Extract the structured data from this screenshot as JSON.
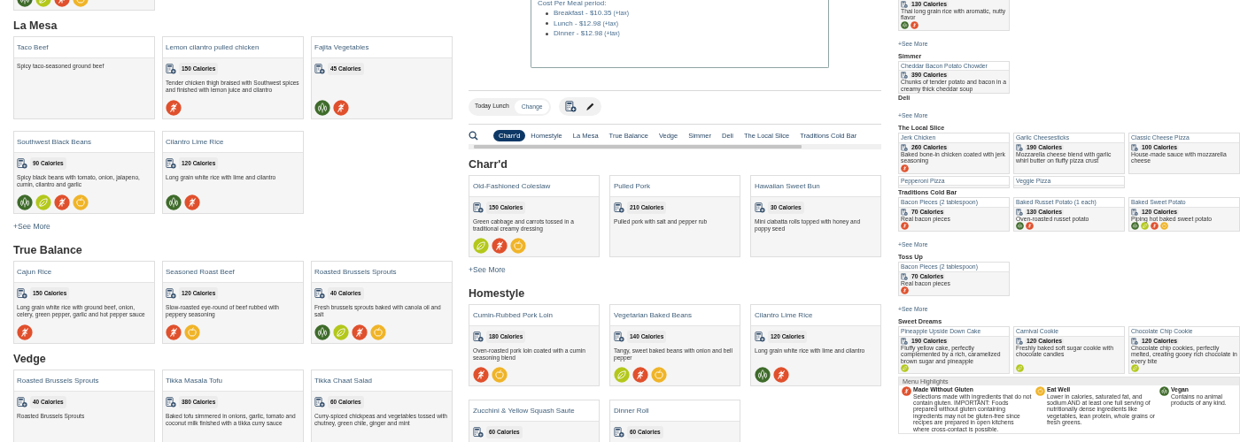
{
  "left_panel": {
    "sections": [
      {
        "items": [
          {
            "badges": [
              {
                "kind": "vegan"
              },
              {
                "kind": "vegetarian"
              },
              {
                "kind": "gluten"
              },
              {
                "kind": "eatwell"
              }
            ]
          }
        ]
      },
      {
        "title": "La Mesa",
        "see_more": "+See More",
        "items": [
          {
            "name": "Taco Beef",
            "description": "Spicy taco-seasoned ground beef"
          },
          {
            "name": "Lemon cilantro pulled chicken",
            "calories": "150 Calories",
            "description": "Tender chicken thigh braised with Southwest spices and finished with lemon juice and cilantro",
            "badges": [
              {
                "kind": "gluten"
              }
            ]
          },
          {
            "name": "Fajita Vegetables",
            "calories": "45 Calories",
            "badges": [
              {
                "kind": "vegan"
              },
              {
                "kind": "gluten"
              }
            ]
          },
          {
            "name": "Southwest Black Beans",
            "calories": "90 Calories",
            "description": "Spicy black beans with tomato, onion, jalapeno, cumin, cilantro and garlic",
            "badges": [
              {
                "kind": "vegan"
              },
              {
                "kind": "vegetarian"
              },
              {
                "kind": "gluten"
              },
              {
                "kind": "eatwell"
              }
            ]
          },
          {
            "name": "Cilantro Lime Rice",
            "calories": "120 Calories",
            "description": "Long grain white rice with lime and cilantro",
            "badges": [
              {
                "kind": "vegan"
              },
              {
                "kind": "gluten"
              }
            ]
          }
        ]
      },
      {
        "title": "True Balance",
        "items": [
          {
            "name": "Cajun Rice",
            "calories": "150 Calories",
            "description": "Long grain white rice with ground beef, onion, celery, green pepper, garlic and hot pepper sauce",
            "badges": [
              {
                "kind": "gluten"
              }
            ]
          },
          {
            "name": "Seasoned Roast Beef",
            "calories": "120 Calories",
            "description": "Slow-roasted eye-round of beef rubbed with peppery seasoning",
            "badges": [
              {
                "kind": "gluten"
              },
              {
                "kind": "eatwell"
              }
            ]
          },
          {
            "name": "Roasted Brussels Sprouts",
            "calories": "40 Calories",
            "description": "Fresh brussels sprouts baked with canola oil and salt",
            "badges": [
              {
                "kind": "vegan"
              },
              {
                "kind": "vegetarian"
              },
              {
                "kind": "gluten"
              },
              {
                "kind": "eatwell"
              }
            ]
          }
        ]
      },
      {
        "title": "Vedge",
        "items": [
          {
            "name": "Roasted Brussels Sprouts",
            "calories": "40 Calories",
            "description": "Roasted Brussels Sprouts"
          },
          {
            "name": "Tikka Masala Tofu",
            "calories": "380 Calories",
            "description": "Baked tofu simmered in onions, garlic, tomato and coconut milk finished with a tikka curry sauce"
          },
          {
            "name": "Tikka Chaat Salad",
            "calories": "60 Calories",
            "description": "Curry-spiced chickpeas and vegetables tossed with chutney, green chile, ginger and mint"
          }
        ]
      }
    ]
  },
  "middle_panel": {
    "cost": {
      "heading": "Cost Per Meal period:",
      "items": [
        {
          "text": "Breakfast - $10.35",
          "note": "(+tax)"
        },
        {
          "text": "Lunch - $12.98",
          "note": "(+tax)"
        },
        {
          "text": "Dinner - $12.98",
          "note": "(+tax)"
        }
      ]
    },
    "toolbar": {
      "day": "Today",
      "meal": "Lunch",
      "change": "Change"
    },
    "tabs": [
      {
        "label": "Charr'd",
        "selected": true
      },
      {
        "label": "Homestyle",
        "selected": false
      },
      {
        "label": "La Mesa",
        "selected": false
      },
      {
        "label": "True Balance",
        "selected": false
      },
      {
        "label": "Vedge",
        "selected": false
      },
      {
        "label": "Simmer",
        "selected": false
      },
      {
        "label": "Deli",
        "selected": false
      },
      {
        "label": "The Local Slice",
        "selected": false
      },
      {
        "label": "Traditions Cold Bar",
        "selected": false
      }
    ],
    "sections": [
      {
        "title": "Charr'd",
        "see_more": "+See More",
        "items": [
          {
            "name": "Old-Fashioned Coleslaw",
            "calories": "150 Calories",
            "description": "Green cabbage and carrots tossed in a traditional creamy dressing",
            "badges": [
              {
                "kind": "vegetarian"
              },
              {
                "kind": "gluten"
              },
              {
                "kind": "eatwell"
              }
            ]
          },
          {
            "name": "Pulled Pork",
            "calories": "210 Calories",
            "description": "Pulled pork with salt and pepper rub"
          },
          {
            "name": "Hawaiian Sweet Bun",
            "calories": "30 Calories",
            "description": "Mini ciabatta rolls topped with honey and poppy seed"
          }
        ]
      },
      {
        "title": "Homestyle",
        "items": [
          {
            "name": "Cumin-Rubbed Pork Loin",
            "calories": "180 Calories",
            "description": "Oven-roasted pork loin coated with a cumin seasoning blend",
            "badges": [
              {
                "kind": "gluten"
              },
              {
                "kind": "eatwell"
              }
            ]
          },
          {
            "name": "Vegetarian Baked Beans",
            "calories": "140 Calories",
            "description": "Tangy, sweet baked beans with onion and bell pepper",
            "badges": [
              {
                "kind": "vegetarian"
              },
              {
                "kind": "gluten"
              },
              {
                "kind": "eatwell"
              }
            ]
          },
          {
            "name": "Cilantro Lime Rice",
            "calories": "120 Calories",
            "description": "Long grain white rice with lime and cilantro",
            "badges": [
              {
                "kind": "vegan"
              },
              {
                "kind": "gluten"
              }
            ]
          },
          {
            "name": "Zucchini & Yellow Squash Saute",
            "calories": "60 Calories"
          },
          {
            "name": "Dinner Roll",
            "calories": "60 Calories"
          }
        ]
      }
    ]
  },
  "right_panel": {
    "upper_sections": [
      {
        "see_more": "+See More",
        "items": [
          {
            "calories": "130 Calories",
            "description": "Thai long grain rice with aromatic, nutty flavor",
            "badges": [
              {
                "kind": "vegan"
              },
              {
                "kind": "gluten"
              }
            ]
          }
        ]
      },
      {
        "title": "Simmer",
        "items": [
          {
            "name": "Cheddar Bacon Potato Chowder",
            "calories": "390 Calories",
            "description": "Chunks of tender potato and bacon in a creamy thick cheddar soup"
          }
        ]
      },
      {
        "title": "Deli",
        "see_more": "+See More"
      },
      {
        "title": "The Local Slice",
        "items": [
          {
            "name": "Jerk Chicken",
            "calories": "260 Calories",
            "description": "Baked bone-in chicken coated with jerk seasoning",
            "badges": [
              {
                "kind": "gluten"
              }
            ]
          },
          {
            "name": "Garlic Cheesesticks",
            "calories": "190 Calories",
            "description": "Mozzarella cheese blend with garlic whirl butter on fluffy pizza crust"
          },
          {
            "name": "Classic Cheese Pizza",
            "calories": "100 Calories",
            "description": "House-made sauce with mozzarella cheese"
          },
          {
            "name": "Pepperoni Pizza"
          },
          {
            "name": "Veggie Pizza"
          }
        ]
      }
    ],
    "lower_sections": [
      {
        "title": "Traditions Cold Bar",
        "see_more": "+See More",
        "items": [
          {
            "name": "Bacon Pieces (2 tablespoon)",
            "calories": "70 Calories",
            "description": "Real bacon pieces",
            "badges": [
              {
                "kind": "gluten"
              }
            ]
          },
          {
            "name": "Baked Russet Potato (1 each)",
            "calories": "130 Calories",
            "description": "Oven-roasted russet potato",
            "badges": [
              {
                "kind": "vegan"
              },
              {
                "kind": "gluten"
              }
            ]
          },
          {
            "name": "Baked Sweet Potato",
            "calories": "120 Calories",
            "description": "Piping hot baked sweet potato",
            "badges": [
              {
                "kind": "vegan"
              },
              {
                "kind": "vegetarian"
              },
              {
                "kind": "gluten"
              },
              {
                "kind": "eatwell"
              }
            ]
          }
        ]
      },
      {
        "title": "Toss Up",
        "see_more": "+See More",
        "items": [
          {
            "name": "Bacon Pieces (2 tablespoon)",
            "calories": "70 Calories",
            "description": "Real bacon pieces",
            "badges": [
              {
                "kind": "gluten"
              }
            ]
          }
        ]
      },
      {
        "title": "Sweet Dreams",
        "items": [
          {
            "name": "Pineapple Upside Down Cake",
            "calories": "190 Calories",
            "description": "Fluffy yellow cake, perfectly complemented by a rich, caramelized brown sugar and pineapple",
            "badges": [
              {
                "kind": "vegetarian"
              }
            ]
          },
          {
            "name": "Carnival Cookie",
            "calories": "120 Calories",
            "description": "Freshly baked soft sugar cookie with chocolate candies",
            "badges": [
              {
                "kind": "vegetarian"
              }
            ]
          },
          {
            "name": "Chocolate Chip Cookie",
            "calories": "120 Calories",
            "description": "Chocolate chip cookies, perfectly melted, creating gooey rich chocolate in every bite",
            "badges": [
              {
                "kind": "vegetarian"
              }
            ]
          }
        ]
      }
    ],
    "highlights": {
      "title": "Menu Highlights",
      "items": [
        {
          "kind": "gluten",
          "title": "Made Without Gluten",
          "text": "Selections made with ingredients that do not contain gluten. IMPORTANT: Foods prepared without gluten containing ingredients may not be gluten-free since recipes are prepared in open kitchens where cross-contact is possible."
        },
        {
          "kind": "eatwell",
          "title": "Eat Well",
          "text": "Lower in calories, saturated fat, and sodium AND at least one full serving of nutritionally dense ingredients like vegetables, lean protein, whole grains or fresh greens."
        },
        {
          "kind": "vegan",
          "title": "Vegan",
          "text": "Contains no animal products of any kind."
        }
      ]
    }
  }
}
